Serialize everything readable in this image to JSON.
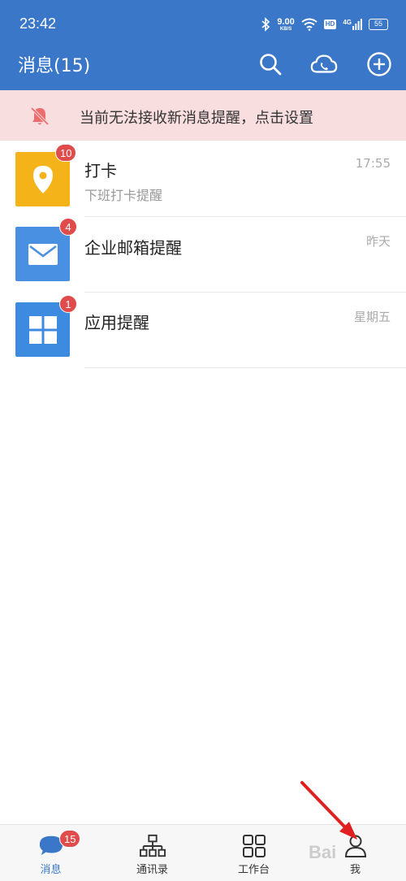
{
  "status_bar": {
    "time": "23:42",
    "net_speed_value": "9.00",
    "net_speed_unit": "KB/S",
    "hd_label": "HD",
    "network_label": "4G",
    "battery": "55"
  },
  "header": {
    "title": "消息(15)",
    "background_color": "#3a77c9"
  },
  "notice": {
    "text": "当前无法接收新消息提醒，点击设置",
    "icon": "bell-off-icon",
    "background_color": "#f8dede"
  },
  "conversations": [
    {
      "title": "打卡",
      "subtitle": "下班打卡提醒",
      "time": "17:55",
      "badge": "10",
      "icon": "location-pin-icon",
      "color": "#f5b31a"
    },
    {
      "title": "企业邮箱提醒",
      "subtitle": "",
      "time": "昨天",
      "badge": "4",
      "icon": "mail-icon",
      "color": "#4a90e2"
    },
    {
      "title": "应用提醒",
      "subtitle": "",
      "time": "星期五",
      "badge": "1",
      "icon": "apps-grid-icon",
      "color": "#3d8be0"
    }
  ],
  "tabbar": {
    "tabs": [
      {
        "label": "消息",
        "icon": "chat-bubble-icon",
        "badge": "15",
        "active": true
      },
      {
        "label": "通讯录",
        "icon": "org-chart-icon",
        "active": false
      },
      {
        "label": "工作台",
        "icon": "grid-icon",
        "active": false
      },
      {
        "label": "我",
        "icon": "person-icon",
        "active": false
      }
    ]
  },
  "watermark": "Bai"
}
